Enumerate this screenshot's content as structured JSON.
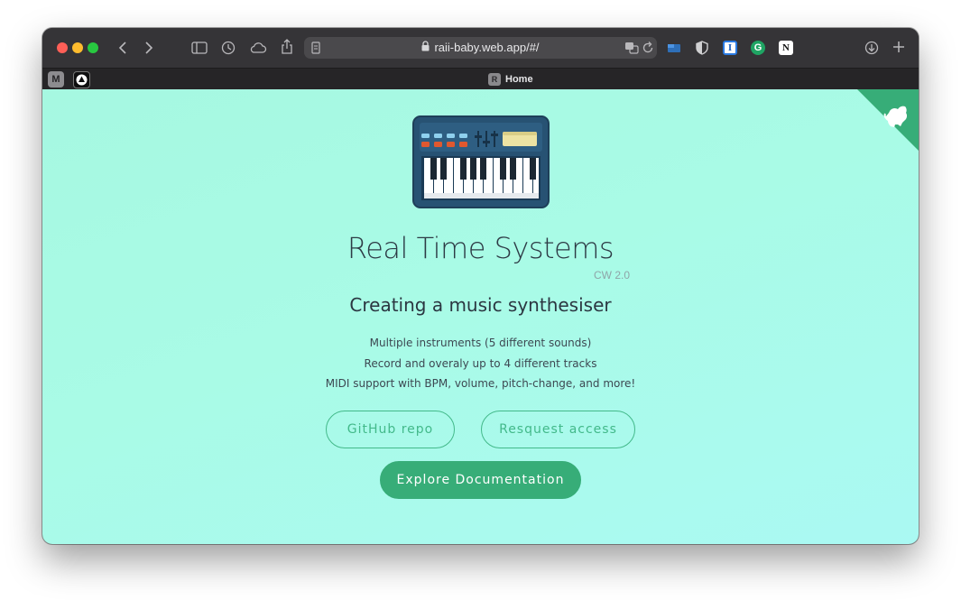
{
  "browser": {
    "url": "raii-baby.web.app/#/",
    "tab": {
      "favicon_letter": "R",
      "title": "Home"
    },
    "pinned_tabs": [
      {
        "icon": "m-icon",
        "letter": "M"
      },
      {
        "icon": "triangle-logo-icon"
      }
    ],
    "extensions": [
      {
        "icon": "translate-icon"
      },
      {
        "icon": "reload-icon"
      },
      {
        "icon": "window-extension-icon"
      },
      {
        "icon": "shield-icon"
      },
      {
        "icon": "instapaper-icon",
        "letter": "I"
      },
      {
        "icon": "grammarly-icon",
        "letter": "G"
      },
      {
        "icon": "notion-icon",
        "letter": "N"
      }
    ]
  },
  "hero": {
    "title": "Real Time Systems",
    "badge": "CW 2.0",
    "subtitle": "Creating a music synthesiser",
    "features": [
      "Multiple instruments (5 different sounds)",
      "Record and overaly up to 4 different tracks",
      "MIDI support with BPM, volume, pitch-change, and more!"
    ],
    "buttons": {
      "github": "GitHub repo",
      "access": "Resquest access",
      "docs": "Explore Documentation"
    }
  },
  "colors": {
    "accent": "#37ad78",
    "page_bg": "#a9fbe6",
    "title": "#2d3a45"
  }
}
